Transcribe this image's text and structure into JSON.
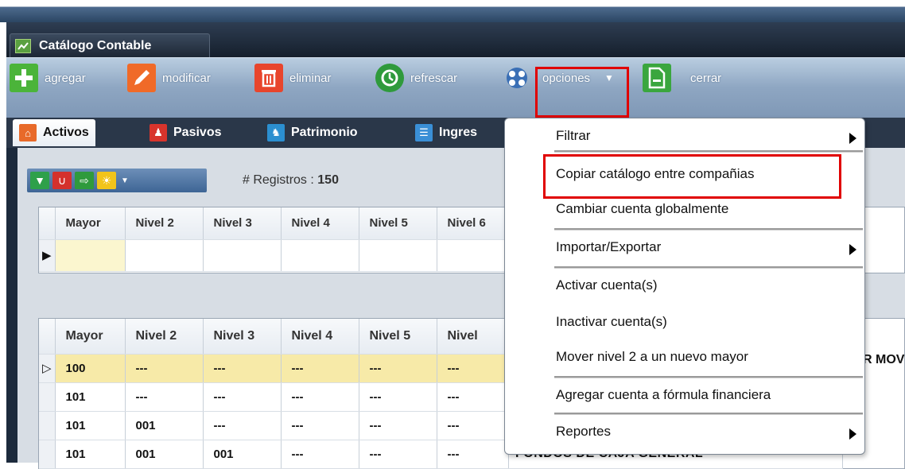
{
  "window": {
    "title": "Catálogo Contable"
  },
  "toolbar": {
    "agregar": "agregar",
    "modificar": "modificar",
    "eliminar": "eliminar",
    "refrescar": "refrescar",
    "opciones": "opciones",
    "cerrar": "cerrar"
  },
  "tabs": [
    {
      "label": "Activos"
    },
    {
      "label": "Pasivos"
    },
    {
      "label": "Patrimonio"
    },
    {
      "label": "Ingres"
    }
  ],
  "records": {
    "label": "# Registros :",
    "count": "150"
  },
  "filter_grid": {
    "columns": [
      "Mayor",
      "Nivel 2",
      "Nivel 3",
      "Nivel 4",
      "Nivel 5",
      "Nivel 6"
    ]
  },
  "main_grid": {
    "columns": [
      "Mayor",
      "Nivel 2",
      "Nivel 3",
      "Nivel 4",
      "Nivel 5",
      "Nivel"
    ],
    "rows": [
      [
        "100",
        "---",
        "---",
        "---",
        "---",
        "---"
      ],
      [
        "101",
        "---",
        "---",
        "---",
        "---",
        "---"
      ],
      [
        "101",
        "001",
        "---",
        "---",
        "---",
        "---"
      ],
      [
        "101",
        "001",
        "001",
        "---",
        "---",
        "---"
      ]
    ],
    "partial_text_mov": "R MOV",
    "partial_text_bottom": "FONDOS DE CAJA GENERAL"
  },
  "context_menu": {
    "items": [
      {
        "label": "Filtrar",
        "submenu": true
      },
      {
        "label": "Copiar catálogo entre compañias",
        "submenu": false
      },
      {
        "label": "Cambiar cuenta globalmente",
        "submenu": false
      },
      {
        "label": "Importar/Exportar",
        "submenu": true
      },
      {
        "label": "Activar cuenta(s)",
        "submenu": false
      },
      {
        "label": "Inactivar cuenta(s)",
        "submenu": false
      },
      {
        "label": "Mover nivel 2 a un nuevo mayor",
        "submenu": false
      },
      {
        "label": "Agregar cuenta a fórmula financiera",
        "submenu": false
      },
      {
        "label": "Reportes",
        "submenu": true
      }
    ]
  },
  "colors": {
    "highlight_box": "#e00000",
    "selected_row": "#f7eaa8",
    "toolbar": "#8ea6c2"
  }
}
